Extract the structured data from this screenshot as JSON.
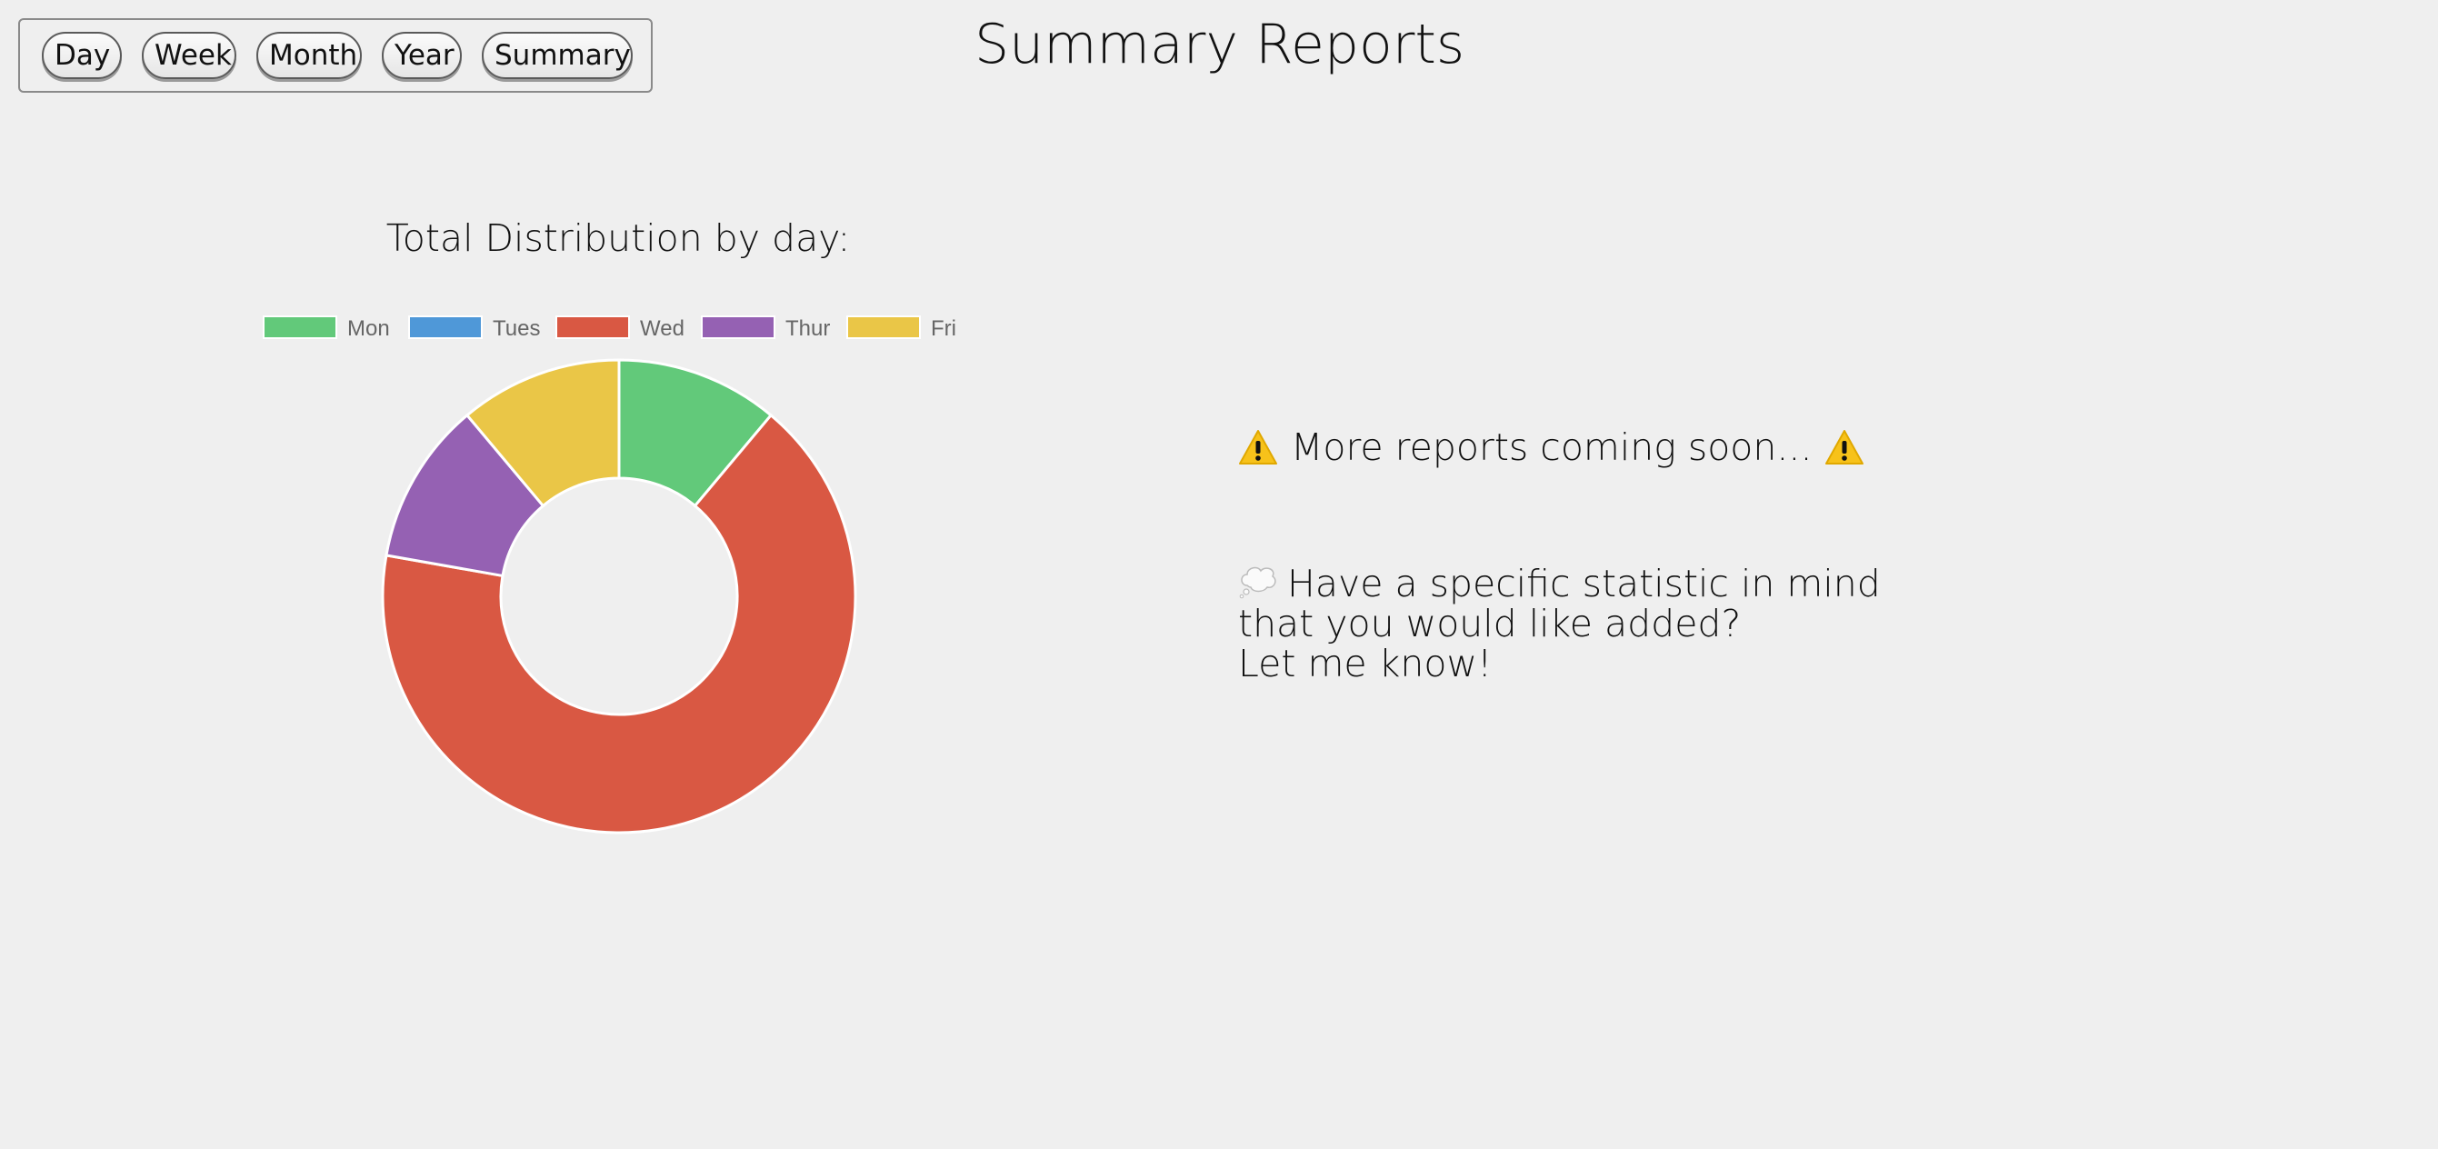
{
  "nav": {
    "buttons": [
      {
        "label": "Day"
      },
      {
        "label": "Week"
      },
      {
        "label": "Month"
      },
      {
        "label": "Year"
      },
      {
        "label": "Summary"
      }
    ]
  },
  "page_title": "Summary Reports",
  "chart_data": {
    "type": "pie",
    "style": "doughnut",
    "title": "Total Distribution by day:",
    "categories": [
      "Mon",
      "Tues",
      "Wed",
      "Thur",
      "Fri"
    ],
    "values": [
      1,
      0,
      6,
      1,
      1
    ],
    "colors": [
      "#62c97a",
      "#4f98d8",
      "#d95843",
      "#9561b3",
      "#eac647"
    ],
    "legend_position": "top"
  },
  "notices": {
    "coming_soon": "More reports coming soon...",
    "coming_soon_icon": "warning-icon",
    "request_icon": "thought-bubble-icon",
    "request_lines": [
      "Have a specific statistic in mind",
      "that you would like added?",
      "Let me know!"
    ]
  }
}
